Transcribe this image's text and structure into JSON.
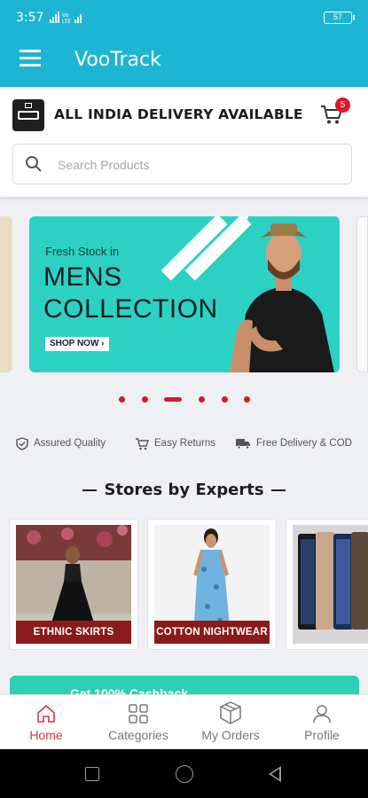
{
  "status_bar": {
    "time": "3:57",
    "network": "Vo LTE",
    "battery": "57"
  },
  "app_bar": {
    "title": "VooTrack"
  },
  "header": {
    "delivery_text": "ALL INDIA DELIVERY AVAILABLE",
    "cart_count": "5"
  },
  "search": {
    "placeholder": "Search Products"
  },
  "banner": {
    "line1": "Fresh Stock in",
    "line2": "MENS",
    "line3": "COLLECTION",
    "cta": "SHOP NOW",
    "cta_arrow": "›",
    "active_index": 2,
    "dot_count": 6
  },
  "features": [
    {
      "icon": "shield-check-icon",
      "label": "Assured Quality"
    },
    {
      "icon": "cart-return-icon",
      "label": "Easy Returns"
    },
    {
      "icon": "truck-icon",
      "label": "Free Delivery & COD"
    }
  ],
  "stores": {
    "title": "Stores by Experts",
    "items": [
      {
        "label": "ETHNIC SKIRTS"
      },
      {
        "label": "COTTON NIGHTWEAR"
      },
      {
        "label": ""
      }
    ]
  },
  "promo": {
    "text": "Get 100% Cashback"
  },
  "bottom_nav": [
    {
      "label": "Home",
      "icon": "home-icon",
      "active": true
    },
    {
      "label": "Categories",
      "icon": "grid-icon",
      "active": false
    },
    {
      "label": "My Orders",
      "icon": "box-icon",
      "active": false
    },
    {
      "label": "Profile",
      "icon": "user-icon",
      "active": false
    }
  ],
  "colors": {
    "primary": "#1cb5d3",
    "accent": "#d9334a",
    "badge": "#e3142a",
    "banner": "#2dd1c4",
    "store_label": "#8b1a1a"
  }
}
